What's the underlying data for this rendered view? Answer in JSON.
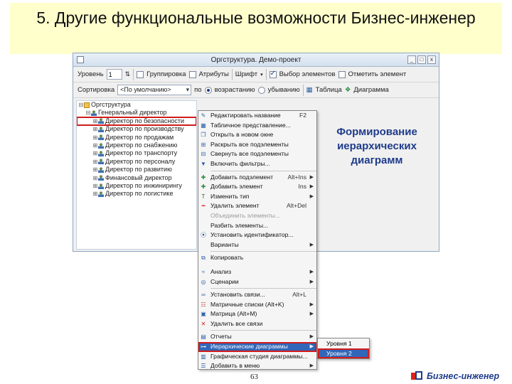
{
  "slide": {
    "title": "5. Другие функциональные возможности Бизнес-инженер",
    "annotation": "Формирование иерархических диаграмм",
    "page_number": "63",
    "brand": "Бизнес-инженер"
  },
  "window": {
    "title": "Оргструктура. Демо-проект",
    "buttons": [
      "_",
      "□",
      "x"
    ]
  },
  "toolbar1": {
    "level_label": "Уровень",
    "level_value": "1",
    "grouping_label": "Группировка",
    "grouping_checked": false,
    "attributes_label": "Атрибуты",
    "attributes_checked": false,
    "font_label": "Шрифт",
    "select_elements_label": "Выбор элементов",
    "select_elements_checked": true,
    "mark_element_label": "Отметить элемент",
    "mark_element_checked": false
  },
  "toolbar2": {
    "sort_label": "Сортировка",
    "sort_value": "<По умолчанию>",
    "order_label": "по",
    "ascending_label": "возрастанию",
    "descending_label": "убыванию",
    "table_label": "Таблица",
    "diagram_label": "Диаграмма"
  },
  "tree": {
    "items": [
      {
        "label": "Оргструктура",
        "icon": "folder-icon",
        "level": 0,
        "toggle": "⊟"
      },
      {
        "label": "Генеральный директор",
        "icon": "person-icon",
        "level": 1,
        "toggle": "⊟"
      },
      {
        "label": "Директор по безопасности",
        "icon": "person-icon",
        "level": 2,
        "toggle": "⊞",
        "highlighted": true
      },
      {
        "label": "Директор по производству",
        "icon": "person-icon",
        "level": 2,
        "toggle": "⊞"
      },
      {
        "label": "Директор по продажам",
        "icon": "person-icon",
        "level": 2,
        "toggle": "⊞"
      },
      {
        "label": "Директор по снабжению",
        "icon": "person-icon",
        "level": 2,
        "toggle": "⊞"
      },
      {
        "label": "Директор по транспорту",
        "icon": "person-icon",
        "level": 2,
        "toggle": "⊞"
      },
      {
        "label": "Директор по персоналу",
        "icon": "person-icon",
        "level": 2,
        "toggle": "⊞"
      },
      {
        "label": "Директор по развитию",
        "icon": "person-icon",
        "level": 2,
        "toggle": "⊞"
      },
      {
        "label": "Финансовый директор",
        "icon": "person-icon",
        "level": 2,
        "toggle": "⊞"
      },
      {
        "label": "Директор по инжинирингу",
        "icon": "person-icon",
        "level": 2,
        "toggle": "⊞"
      },
      {
        "label": "Директор по логистике",
        "icon": "person-icon",
        "level": 2,
        "toggle": "⊞"
      }
    ]
  },
  "context_menu": {
    "items": [
      {
        "label": "Редактировать название",
        "shortcut": "F2",
        "icon": "edit-icon"
      },
      {
        "label": "Табличное представление...",
        "icon": "table-icon"
      },
      {
        "label": "Открыть в новом окне",
        "icon": "window-icon"
      },
      {
        "label": "Раскрыть все подэлементы",
        "icon": "expand-icon"
      },
      {
        "label": "Свернуть все подэлементы",
        "icon": "collapse-icon"
      },
      {
        "label": "Включить фильтры...",
        "icon": "filter-icon"
      },
      {
        "sep": true
      },
      {
        "label": "Добавить подэлемент",
        "shortcut": "Alt+Ins",
        "arrow": true,
        "icon": "add-child-icon"
      },
      {
        "label": "Добавить элемент",
        "shortcut": "Ins",
        "arrow": true,
        "icon": "add-icon"
      },
      {
        "label": "Изменить тип",
        "arrow": true,
        "icon": "type-icon"
      },
      {
        "label": "Удалить элемент",
        "shortcut": "Alt+Del",
        "icon": "delete-icon"
      },
      {
        "label": "Объединить элементы...",
        "disabled": true
      },
      {
        "label": "Разбить элементы..."
      },
      {
        "label": "Установить идентификатор...",
        "icon": "id-icon"
      },
      {
        "label": "Варианты",
        "arrow": true
      },
      {
        "sep": true
      },
      {
        "label": "Копировать",
        "icon": "copy-icon"
      },
      {
        "gap": true
      },
      {
        "label": "Анализ",
        "arrow": true,
        "icon": "analysis-icon"
      },
      {
        "label": "Сценарии",
        "arrow": true,
        "icon": "scenario-icon"
      },
      {
        "sep": true
      },
      {
        "label": "Установить связи...",
        "shortcut": "Alt+L",
        "icon": "link-icon"
      },
      {
        "label": "Матричные списки (Alt+K)",
        "arrow": true,
        "icon": "matrix-list-icon"
      },
      {
        "label": "Матрица (Alt+M)",
        "arrow": true,
        "icon": "matrix-icon"
      },
      {
        "label": "Удалить все связи",
        "icon": "unlink-icon"
      },
      {
        "sep": true
      },
      {
        "label": "Отчеты",
        "arrow": true,
        "icon": "report-icon"
      },
      {
        "label": "Иерархические диаграммы",
        "arrow": true,
        "icon": "hierarchy-icon",
        "active": true
      },
      {
        "label": "Графическая студия диаграммы...",
        "icon": "chart-icon"
      },
      {
        "label": "Добавить в меню",
        "arrow": true,
        "icon": "menu-icon"
      }
    ]
  },
  "submenu": {
    "items": [
      {
        "label": "Уровня 1"
      },
      {
        "label": "Уровня 2",
        "active": true
      }
    ]
  },
  "colors": {
    "title_bg": "#ffffcc",
    "accent": "#1f3c8c",
    "highlight": "#d11c1c",
    "selection": "#3166b8"
  }
}
